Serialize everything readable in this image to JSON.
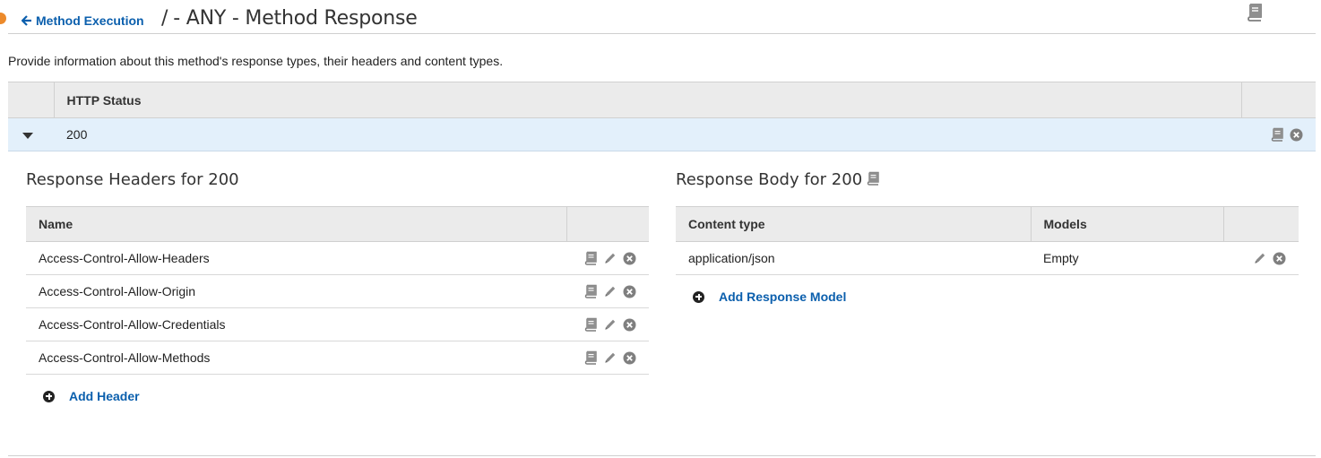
{
  "header": {
    "back_label": "Method Execution",
    "title_sep": "/",
    "title": "- ANY - Method Response"
  },
  "description": "Provide information about this method's response types, their headers and content types.",
  "status_table": {
    "column_status": "HTTP Status",
    "rows": [
      {
        "status": "200"
      }
    ]
  },
  "headers_section": {
    "title": "Response Headers for 200",
    "column_name": "Name",
    "rows": [
      {
        "name": "Access-Control-Allow-Headers"
      },
      {
        "name": "Access-Control-Allow-Origin"
      },
      {
        "name": "Access-Control-Allow-Credentials"
      },
      {
        "name": "Access-Control-Allow-Methods"
      }
    ],
    "add_label": "Add Header"
  },
  "body_section": {
    "title": "Response Body for 200",
    "column_content_type": "Content type",
    "column_models": "Models",
    "rows": [
      {
        "content_type": "application/json",
        "model": "Empty"
      }
    ],
    "add_label": "Add Response Model"
  },
  "icons": {
    "book": "book-icon",
    "pencil": "pencil-icon",
    "remove": "remove-circle-icon",
    "back": "arrow-left-icon",
    "caret": "caret-down-icon",
    "add": "plus-circle-icon"
  },
  "colors": {
    "link": "#0b5fad",
    "selected_row": "#e3f0fb",
    "header_bg": "#ebebeb",
    "icon_gray": "#8a8a8a",
    "status_dot": "#ec8a2b"
  }
}
